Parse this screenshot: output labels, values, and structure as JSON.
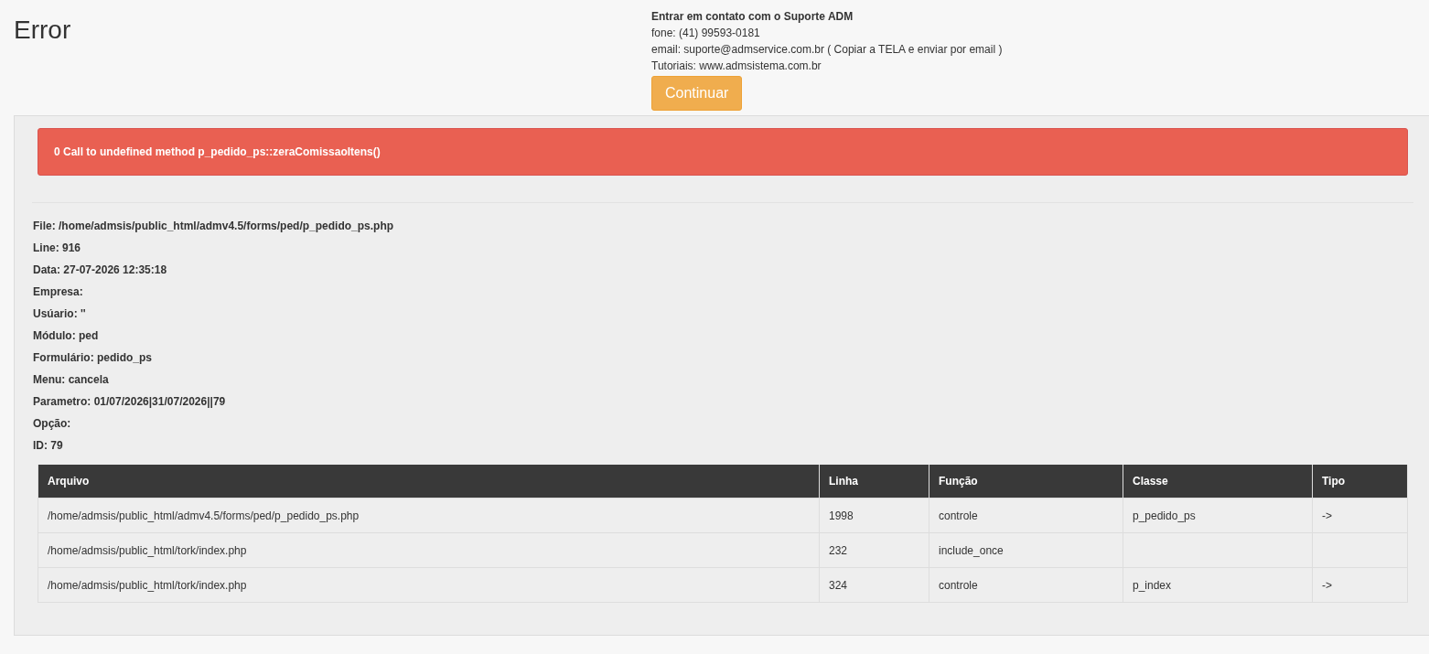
{
  "page_title": "Error",
  "contact": {
    "heading": "Entrar em contato com o Suporte ADM",
    "lines": [
      "fone: (41) 99593-0181",
      "email: suporte@admservice.com.br ( Copiar a TELA e enviar por email )",
      "Tutoriais: www.admsistema.com.br"
    ],
    "button": "Continuar"
  },
  "alert": "0 Call to undefined method p_pedido_ps::zeraComissaoItens()",
  "details": [
    "File: /home/admsis/public_html/admv4.5/forms/ped/p_pedido_ps.php",
    "Line: 916",
    "Data: 27-07-2026 12:35:18",
    "Empresa:",
    "Usúario: ''",
    "Módulo: ped",
    "Formulário: pedido_ps",
    "Menu: cancela",
    "Parametro: 01/07/2026|31/07/2026||79",
    "Opção:",
    "ID: 79"
  ],
  "table": {
    "columns": [
      "Arquivo",
      "Linha",
      "Função",
      "Classe",
      "Tipo"
    ],
    "rows": [
      [
        "/home/admsis/public_html/admv4.5/forms/ped/p_pedido_ps.php",
        "1998",
        "controle",
        "p_pedido_ps",
        "->"
      ],
      [
        "/home/admsis/public_html/tork/index.php",
        "232",
        "include_once",
        null,
        null
      ],
      [
        "/home/admsis/public_html/tork/index.php",
        "324",
        "controle",
        "p_index",
        "->"
      ]
    ]
  }
}
